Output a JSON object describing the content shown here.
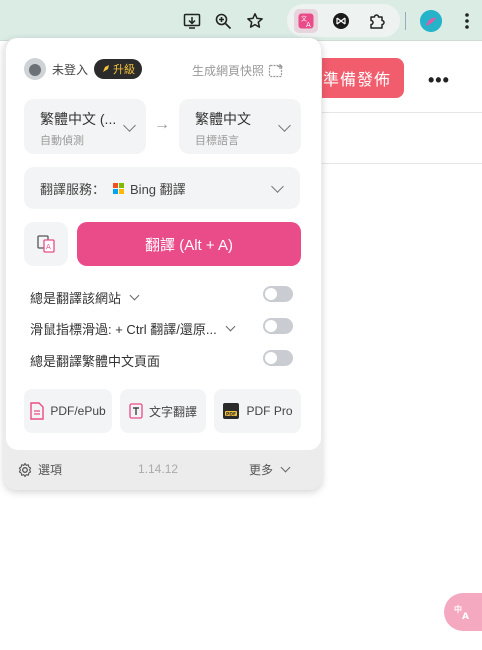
{
  "page": {
    "publish_button": "準備發佈",
    "more_menu": "•••",
    "float_translate": "文A"
  },
  "toolbar": {
    "icons": [
      "install-app-icon",
      "zoom-icon",
      "bookmark-star-icon",
      "translate-extension-icon",
      "extension-icon",
      "puzzle-extensions-icon",
      "profile-avatar",
      "kebab-menu-icon"
    ],
    "colors": {
      "bg": "#dbece5"
    }
  },
  "popup": {
    "login_label": "未登入",
    "upgrade_label": "升級",
    "snapshot_label": "生成網頁快照",
    "source_lang": {
      "main": "繁體中文 (...",
      "sub": "自動偵測"
    },
    "target_lang": {
      "main": "繁體中文",
      "sub": "目標語言"
    },
    "service_label": "翻譯服務：",
    "service_value": "Bing 翻譯",
    "translate_button": "翻譯 (Alt + A)",
    "options": [
      {
        "label": "總是翻譯該網站",
        "has_dropdown": true,
        "enabled": false
      },
      {
        "label": "滑鼠指標滑過:  + Ctrl 翻譯/還原...",
        "has_dropdown": true,
        "enabled": false
      },
      {
        "label": "總是翻譯繁體中文頁面",
        "has_dropdown": false,
        "enabled": false
      }
    ],
    "tools": [
      {
        "label": "PDF/ePub",
        "icon": "pdf-file-icon"
      },
      {
        "label": "文字翻譯",
        "icon": "text-translate-icon"
      },
      {
        "label": "PDF Pro",
        "icon": "pdf-pro-icon"
      }
    ],
    "footer": {
      "settings_label": "選項",
      "version": "1.14.12",
      "more_label": "更多"
    },
    "colors": {
      "accent": "#ea4c89",
      "publish": "#f25d6e"
    }
  }
}
